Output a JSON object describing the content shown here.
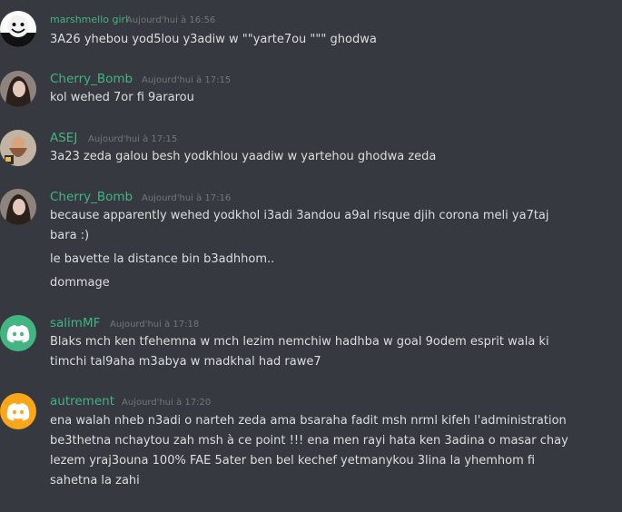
{
  "colors": {
    "background": "#36393f",
    "username": "#43b581",
    "timestamp": "#72767d",
    "text": "#dcddde",
    "discord_blurple": "#7289da",
    "discord_green": "#43b581",
    "discord_orange": "#faa61a"
  },
  "messages": [
    {
      "author": "marshmello girl",
      "timestamp": "Aujourd'hui à 16:56",
      "avatar": "marshmello-avatar",
      "lines": [
        "3A26 yhebou yod5lou y3adiw w \"\"yarte7ou \"\"\" ghodwa"
      ]
    },
    {
      "author": "Cherry_Bomb",
      "timestamp": "Aujourd'hui à 17:15",
      "avatar": "user-photo-avatar",
      "lines": [
        "kol wehed 7or fi 9ararou"
      ]
    },
    {
      "author": "ASEJ",
      "timestamp": "Aujourd'hui à 17:15",
      "avatar": "user-photo-avatar",
      "lines": [
        "3a23 zeda galou besh yodkhlou yaadiw  w yartehou ghodwa zeda"
      ]
    },
    {
      "author": "Cherry_Bomb",
      "timestamp": "Aujourd'hui à 17:16",
      "avatar": "user-photo-avatar",
      "lines": [
        "because apparently wehed yodkhol i3adi 3andou a9al risque djih corona meli ya7taj",
        "bara :)",
        "le bavette la distance bin b3adhhom..",
        "dommage"
      ]
    },
    {
      "author": "salimMF",
      "timestamp": "Aujourd'hui à 17:18",
      "avatar": "discord-default-avatar",
      "lines": [
        "Blaks mch ken tfehemna w mch lezim nemchiw hadhba w goal 9odem esprit wala ki",
        "timchi tal9aha m3abya w madkhal had rawe7"
      ]
    },
    {
      "author": "autrement",
      "timestamp": "Aujourd'hui à 17:20",
      "avatar": "discord-default-avatar",
      "lines": [
        "ena walah nheb n3adi o narteh zeda ama bsaraha fadit msh nrml kifeh l'administration",
        "be3thetna nchaytou zah msh à ce point !!! ena men rayi hata ken 3adina o masar chay",
        "lezem yraj3ouna 100% FAE 5ater ben bel kechef yetmanykou 3lina la yhemhom fi",
        "sahetna la zahi"
      ]
    }
  ]
}
